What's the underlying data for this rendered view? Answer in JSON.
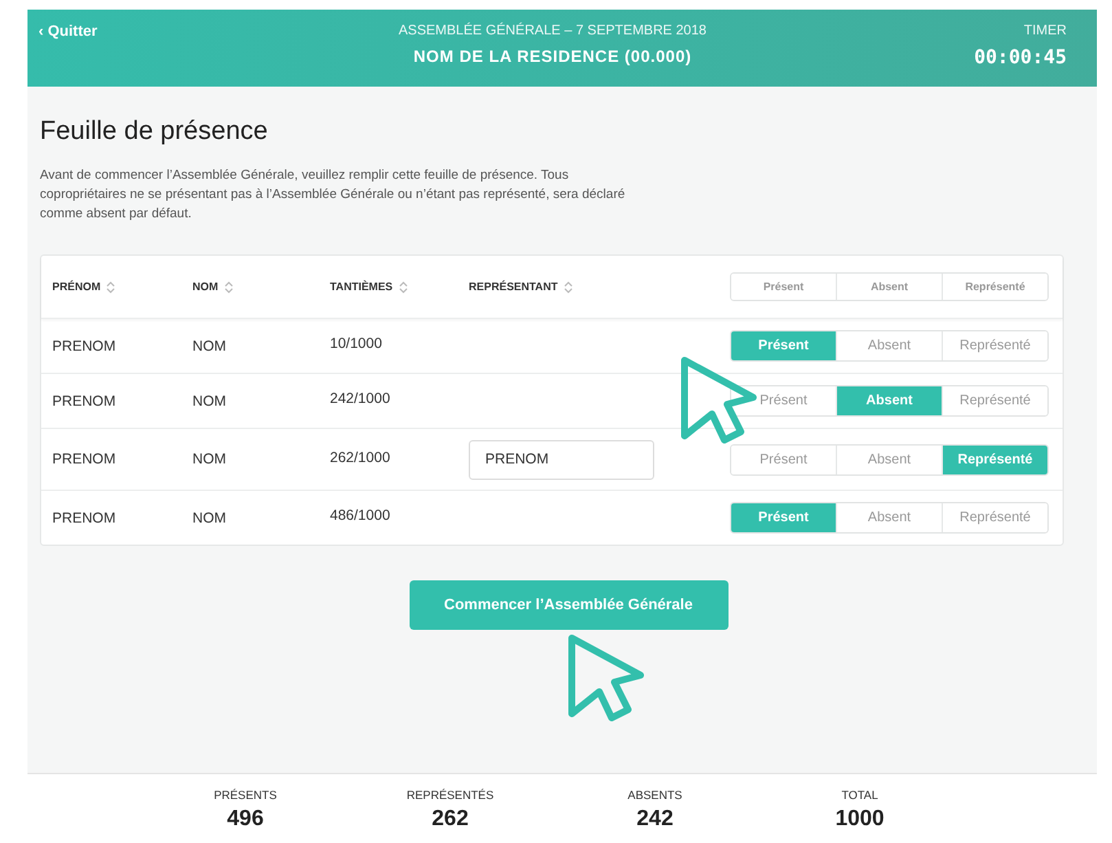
{
  "header": {
    "back": "‹ Quitter",
    "subtitle": "ASSEMBLÉE GÉNÉRALE – 7 SEPTEMBRE 2018",
    "title": "NOM DE LA RESIDENCE (00.000)",
    "timer_label": "TIMER",
    "timer": "00:00:45"
  },
  "page": {
    "title": "Feuille de présence",
    "intro": "Avant de commencer l’Assemblée Générale, veuillez remplir cette feuille de présence. Tous copropriétaires ne se présentant pas à l’Assemblée Générale ou n’étant pas représenté, sera déclaré comme absent par défaut."
  },
  "table": {
    "columns": [
      "PRÉNOM",
      "NOM",
      "TANTIÈMES",
      "REPRÉSENTANT"
    ],
    "filter": [
      {
        "label": "Présent",
        "selected": false
      },
      {
        "label": "Absent",
        "selected": false
      },
      {
        "label": "Représenté",
        "selected": false
      }
    ],
    "rows": [
      {
        "prenom": "PRENOM",
        "nom": "NOM",
        "tantiemes": "10/1000",
        "status": [
          {
            "label": "Présent",
            "selected": true
          },
          {
            "label": "Absent",
            "selected": false
          },
          {
            "label": "Représenté",
            "selected": false
          }
        ]
      },
      {
        "prenom": "PRENOM",
        "nom": "NOM",
        "tantiemes": "242/1000",
        "status": [
          {
            "label": "Présent",
            "selected": false
          },
          {
            "label": "Absent",
            "selected": true
          },
          {
            "label": "Représenté",
            "selected": false
          }
        ]
      },
      {
        "prenom": "PRENOM",
        "nom": "NOM",
        "tantiemes": "262/1000",
        "representant": "PRENOM",
        "status": [
          {
            "label": "Présent",
            "selected": false
          },
          {
            "label": "Absent",
            "selected": false
          },
          {
            "label": "Représenté",
            "selected": true
          }
        ]
      },
      {
        "prenom": "PRENOM",
        "nom": "NOM",
        "tantiemes": "486/1000",
        "status": [
          {
            "label": "Présent",
            "selected": true
          },
          {
            "label": "Absent",
            "selected": false
          },
          {
            "label": "Représenté",
            "selected": false
          }
        ]
      }
    ]
  },
  "start_button": "Commencer l’Assemblée Générale",
  "totals": [
    {
      "label": "PRÉSENTS",
      "value": "496"
    },
    {
      "label": "REPRÉSENTÉS",
      "value": "262"
    },
    {
      "label": "ABSENTS",
      "value": "242"
    },
    {
      "label": "TOTAL",
      "value": "1000"
    }
  ]
}
